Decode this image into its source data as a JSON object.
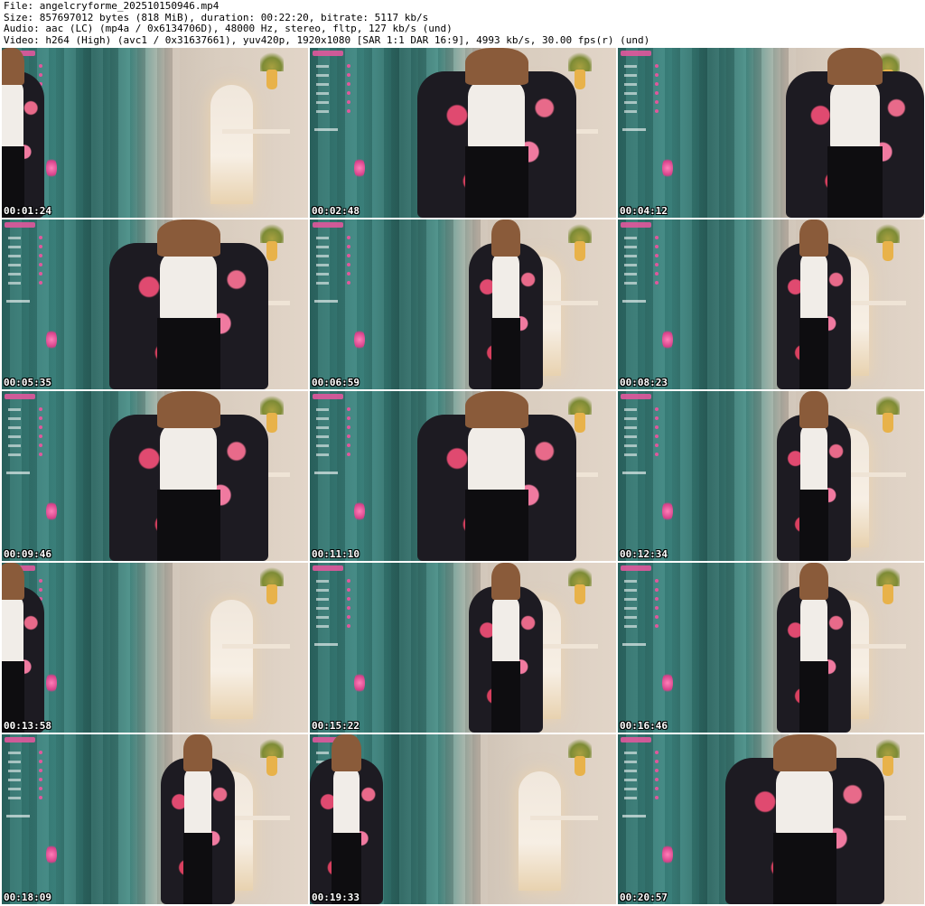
{
  "header": {
    "line1": "File: angelcryforme_202510150946.mp4",
    "line2": "Size: 857697012 bytes (818 MiB), duration: 00:22:20, bitrate: 5117 kb/s",
    "line3": "Audio: aac (LC) (mp4a / 0x6134706D), 48000 Hz, stereo, fltp, 127 kb/s (und)",
    "line4": "Video: h264 (High) (avc1 / 0x31637661), yuv420p, 1920x1080 [SAR 1:1 DAR 16:9], 4993 kb/s, 30.00 fps(r) (und)"
  },
  "frames": [
    {
      "timestamp": "00:01:24",
      "scene": "wide-left"
    },
    {
      "timestamp": "00:02:48",
      "scene": "close"
    },
    {
      "timestamp": "00:04:12",
      "scene": "close-right"
    },
    {
      "timestamp": "00:05:35",
      "scene": "close"
    },
    {
      "timestamp": "00:06:59",
      "scene": "wide"
    },
    {
      "timestamp": "00:08:23",
      "scene": "wide"
    },
    {
      "timestamp": "00:09:46",
      "scene": "close"
    },
    {
      "timestamp": "00:11:10",
      "scene": "close"
    },
    {
      "timestamp": "00:12:34",
      "scene": "wide"
    },
    {
      "timestamp": "00:13:58",
      "scene": "wide-left"
    },
    {
      "timestamp": "00:15:22",
      "scene": "wide"
    },
    {
      "timestamp": "00:16:46",
      "scene": "wide"
    },
    {
      "timestamp": "00:18:09",
      "scene": "wide"
    },
    {
      "timestamp": "00:19:33",
      "scene": "close-left"
    },
    {
      "timestamp": "00:20:57",
      "scene": "close"
    }
  ],
  "colors": {
    "curtain": "#2f6f6a",
    "wall": "#d9cdbf",
    "robe": "#1d1b22",
    "blossom": "#e04a70",
    "shirt": "#f1ede8",
    "overlay_accent": "#e0589c",
    "timestamp_text": "#ffffff"
  }
}
